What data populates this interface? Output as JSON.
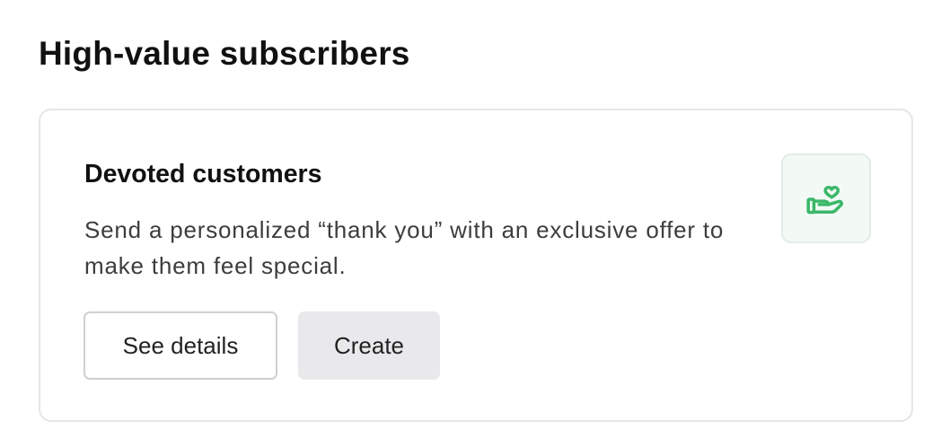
{
  "section": {
    "title": "High-value subscribers"
  },
  "card": {
    "title": "Devoted customers",
    "description": "Send a personalized “thank you” with an exclusive offer to make them feel special.",
    "icon": "hand-heart-icon",
    "icon_color": "#3bb86a",
    "buttons": {
      "see_details_label": "See details",
      "create_label": "Create"
    }
  }
}
